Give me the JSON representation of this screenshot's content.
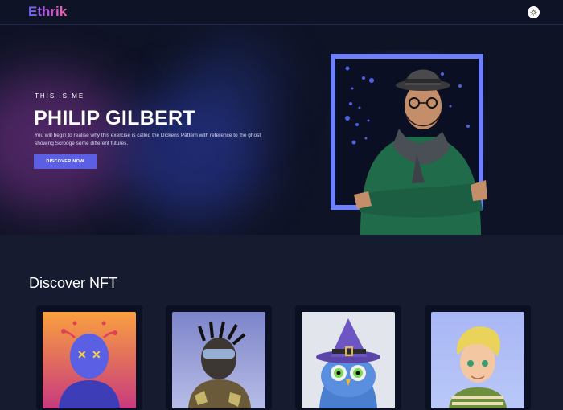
{
  "brand": {
    "name": "Ethrik"
  },
  "header": {
    "theme_toggle_icon": "sun-icon"
  },
  "hero": {
    "eyebrow": "THIS  IS  ME",
    "title": "PHILIP GILBERT",
    "description": "You will begin to realise why this exercise is called the Dickens Pattern with reference to the ghost showing Scrooge some different futures.",
    "cta_label": "DISCOVER NOW"
  },
  "discover": {
    "title": "Discover NFT"
  },
  "colors": {
    "accent": "#5a5fe3",
    "background": "#161b30",
    "hero_bg": "#0f1326"
  }
}
